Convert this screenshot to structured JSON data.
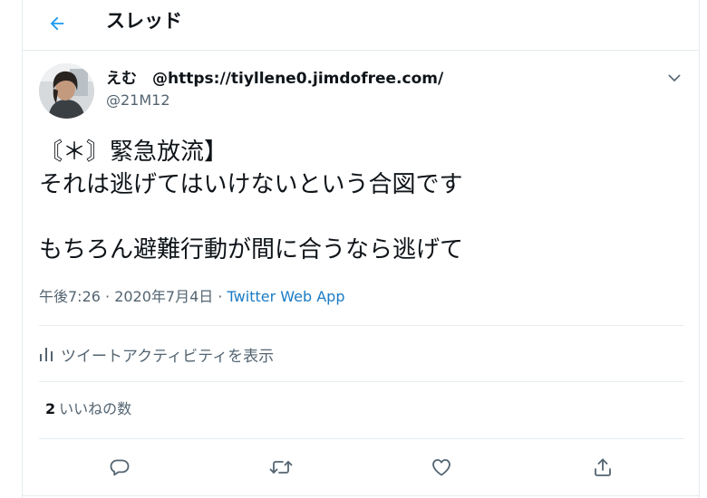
{
  "header": {
    "back_icon": "arrow-left-icon",
    "title": "スレッド"
  },
  "author": {
    "display_name": "えむ　@https://tiyllene0.jimdofree.com/",
    "handle": "@21M12",
    "avatar_icon": "profile-photo",
    "menu_icon": "chevron-down-icon"
  },
  "tweet": {
    "lines": [
      "〘＊〙緊急放流】",
      "それは逃げてはいけないという合図です",
      "",
      "もちろん避難行動が間に合うなら逃げて"
    ],
    "timestamp": "午後7:26 · 2020年7月4日 · ",
    "source": "Twitter Web App"
  },
  "activity": {
    "icon": "bar-chart-icon",
    "label": "ツイートアクティビティを表示"
  },
  "stats": {
    "likes_count": "2",
    "likes_label": "いいねの数"
  },
  "actions": [
    {
      "name": "reply",
      "icon": "reply-icon"
    },
    {
      "name": "retweet",
      "icon": "retweet-icon"
    },
    {
      "name": "like",
      "icon": "heart-icon"
    },
    {
      "name": "share",
      "icon": "share-icon"
    }
  ],
  "colors": {
    "accent": "#1d9bf0",
    "link": "#1b7bc4",
    "text": "#0f1419",
    "muted": "#536471",
    "border": "#e6ecf0"
  }
}
